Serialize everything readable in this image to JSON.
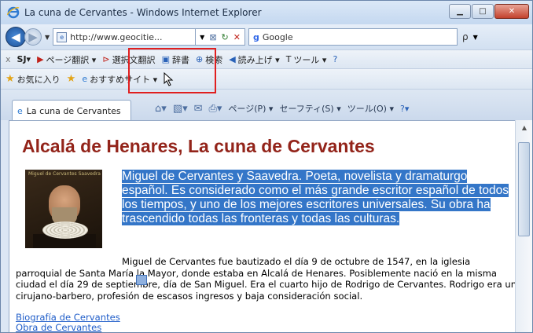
{
  "window": {
    "title": "La cuna de Cervantes - Windows Internet Explorer"
  },
  "address": {
    "url": "http://www.geocitie...",
    "search_engine": "Google",
    "search_icon_label": "ρ"
  },
  "toolbar": {
    "close": "x",
    "sj": "SJ▾",
    "page_translate": "ページ翻訳 ▾",
    "selection_translate": "選択文翻訳",
    "dictionary": "辞書",
    "search": "検索",
    "read_aloud": "読み上げ ▾",
    "tools": "ツール ▾"
  },
  "favorites": {
    "label": "お気に入り",
    "recommended": "おすすめサイト ▾"
  },
  "tab": {
    "label": "La cuna de Cervantes"
  },
  "command_bar": {
    "page": "ページ(P) ▾",
    "safety": "セーフティ(S) ▾",
    "tools": "ツール(O) ▾",
    "help": "?▾"
  },
  "page": {
    "heading": "Alcalá de Henares, La cuna de Cervantes",
    "portrait_caption": "Miguel de Cervantes Saavedra",
    "highlight": "Miguel de Cervantes y Saavedra.  Poeta, novelista y dramaturgo español.  Es considerado como el más grande escritor español de todos los tiempos, y uno de los mejores escritores universales. Su obra ha trascendido todas las fronteras y todas las culturas.",
    "paragraph": "Miguel de Cervantes fue bautizado el día 9 de octubre de 1547, en la iglesia parroquial de Santa María la Mayor, donde estaba en Alcalá de Henares. Posiblemente nació en la misma ciudad el día 29 de septiembre, día de San Miguel.  Era el cuarto hijo de Rodrigo de Cervantes.  Rodrigo era un cirujano-barbero, profesión de escasos ingresos y baja consideración social.",
    "link1": "Biografía de Cervantes",
    "link2": "Obra de Cervantes"
  },
  "colors": {
    "heading": "#93241a",
    "selection": "#3476c8",
    "link": "#1f5dc9",
    "callout": "#e01f1f"
  }
}
